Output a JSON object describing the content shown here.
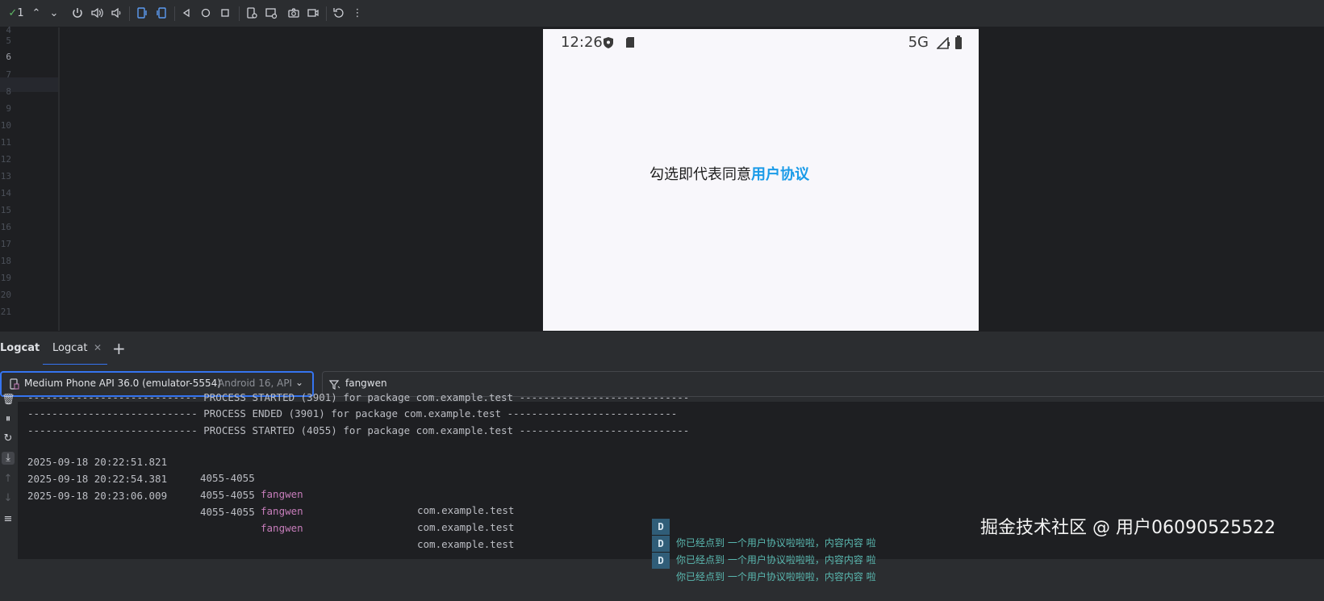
{
  "toolbar": {
    "run_count": "1",
    "buttons": [
      "power-icon",
      "volume-up-icon",
      "volume-down-icon",
      "rotate-left-icon",
      "rotate-right-icon",
      "back-icon",
      "home-icon",
      "overview-icon",
      "fold-icon",
      "snapshot-icon",
      "camera-icon",
      "record-icon",
      "reset-icon",
      "more-icon"
    ]
  },
  "gutter": {
    "line_numbers": [
      "4",
      "5",
      "6",
      "7",
      "8",
      "9",
      "10",
      "11",
      "12",
      "13",
      "14",
      "15",
      "16",
      "17",
      "18",
      "19",
      "20",
      "21"
    ],
    "active_line": "6"
  },
  "emulator": {
    "status_time": "12:26",
    "network": "5G",
    "agreement_text": "勾选即代表同意",
    "agreement_link": "用户协议"
  },
  "logcat": {
    "panel_title": "Logcat",
    "tab_label": "Logcat",
    "device_name": "Medium Phone API 36.0 (emulator-5554)",
    "device_extra": "Android 16, API",
    "filter_value": "fangwen",
    "process_lines": [
      "---------------------------- PROCESS STARTED (3901) for package com.example.test ----------------------------",
      "---------------------------- PROCESS ENDED (3901) for package com.example.test ----------------------------",
      "---------------------------- PROCESS STARTED (4055) for package com.example.test ----------------------------"
    ],
    "entries": [
      {
        "datetime": "2025-09-18 20:22:51.821",
        "pid": "4055-4055",
        "tag": "fangwen",
        "package": "com.example.test",
        "level": "D",
        "message": "你已经点到 一个用户协议啦啦啦，内容内容 啦"
      },
      {
        "datetime": "2025-09-18 20:22:54.381",
        "pid": "4055-4055",
        "tag": "fangwen",
        "package": "com.example.test",
        "level": "D",
        "message": "你已经点到 一个用户协议啦啦啦，内容内容 啦"
      },
      {
        "datetime": "2025-09-18 20:23:06.009",
        "pid": "4055-4055",
        "tag": "fangwen",
        "package": "com.example.test",
        "level": "D",
        "message": "你已经点到 一个用户协议啦啦啦，内容内容 啦"
      }
    ]
  },
  "watermark": "掘金技术社区 @ 用户06090525522",
  "colors": {
    "accent": "#3574f0",
    "link": "#1a9be8",
    "tag": "#c77dbb",
    "message": "#5ab8b0",
    "level_badge": "#305d78"
  }
}
